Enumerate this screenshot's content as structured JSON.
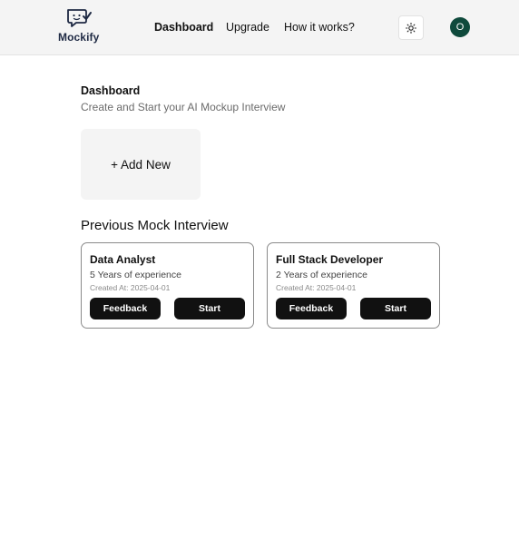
{
  "brand": {
    "name": "Mockify"
  },
  "nav": {
    "links": [
      {
        "label": "Dashboard",
        "active": true
      },
      {
        "label": "Upgrade",
        "active": false
      },
      {
        "label": "How it works?",
        "active": false
      }
    ],
    "theme_icon": "sun-icon",
    "avatar_initial": "O",
    "avatar_color": "#0f4a3c"
  },
  "dashboard": {
    "title": "Dashboard",
    "subtitle": "Create and Start your AI Mockup Interview",
    "add_new_label": "+ Add New"
  },
  "previous": {
    "title": "Previous Mock Interview",
    "interviews": [
      {
        "role": "Data Analyst",
        "experience": "5 Years of experience",
        "created": "Created At: 2025-04-01",
        "feedback_label": "Feedback",
        "start_label": "Start"
      },
      {
        "role": "Full Stack Developer",
        "experience": "2 Years of experience",
        "created": "Created At: 2025-04-01",
        "feedback_label": "Feedback",
        "start_label": "Start"
      }
    ]
  }
}
